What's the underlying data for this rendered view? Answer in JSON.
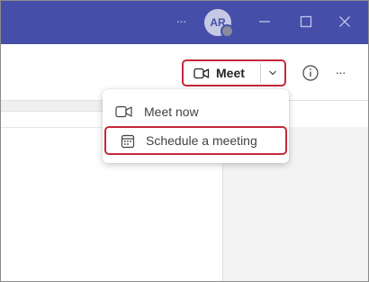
{
  "titlebar": {
    "more_icon": "ellipsis-icon",
    "avatar_initials": "AR",
    "presence": "offline",
    "minimize_icon": "minimize-icon",
    "maximize_icon": "maximize-icon",
    "close_icon": "close-icon",
    "background": "#454fa9"
  },
  "toolbar": {
    "meet_label": "Meet",
    "meet_icon": "video-camera-icon",
    "dropdown_icon": "chevron-down-icon",
    "info_icon": "info-icon",
    "more_label": "···",
    "highlight_color": "#c6283a"
  },
  "meet_menu": {
    "items": [
      {
        "label": "Meet now",
        "icon": "video-camera-icon"
      },
      {
        "label": "Schedule a meeting",
        "icon": "calendar-icon"
      }
    ]
  }
}
